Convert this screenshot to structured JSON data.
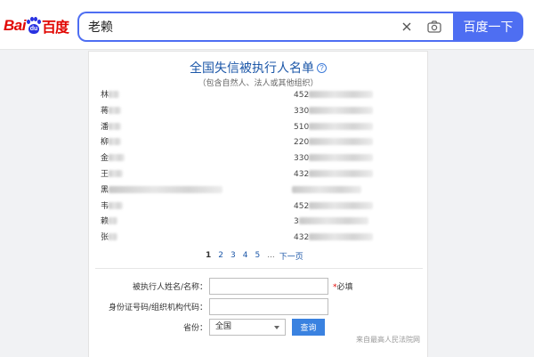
{
  "header": {
    "logo_text_en": "Bai",
    "logo_text_du": "du",
    "logo_text_cn": "百度",
    "search_value": "老赖",
    "search_button_label": "百度一下"
  },
  "card": {
    "title": "全国失信被执行人名单",
    "subtitle": "（包含自然人、法人或其他组织）",
    "rows": [
      {
        "name": "林",
        "id": "452"
      },
      {
        "name": "蒋",
        "id": "330"
      },
      {
        "name": "潘",
        "id": "510"
      },
      {
        "name": "柳",
        "id": "220"
      },
      {
        "name": "金",
        "id": "330"
      },
      {
        "name": "王",
        "id": "432"
      },
      {
        "name": "黑",
        "id": ""
      },
      {
        "name": "韦",
        "id": "452"
      },
      {
        "name": "赖",
        "id": "3"
      },
      {
        "name": "张",
        "id": "432"
      }
    ],
    "pagination": {
      "pages": [
        "1",
        "2",
        "3",
        "4",
        "5"
      ],
      "current": "1",
      "ellipsis": "...",
      "next_label": "下一页"
    },
    "form": {
      "name_label": "被执行人姓名/名称：",
      "name_value": "",
      "required_star": "*",
      "required_text": "必填",
      "id_label": "身份证号码/组织机构代码：",
      "id_value": "",
      "province_label": "省份：",
      "province_value": "全国",
      "query_button_label": "查询"
    },
    "source_text": "来自最高人民法院网"
  },
  "colors": {
    "brand_blue": "#4e6ef2",
    "baidu_red": "#e10602",
    "link_blue": "#1c57a8",
    "query_blue": "#3a82e0"
  }
}
